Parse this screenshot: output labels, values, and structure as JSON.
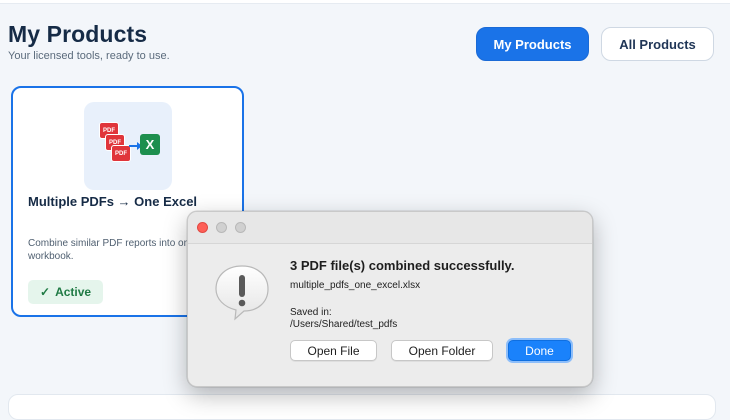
{
  "header": {
    "title": "My Products",
    "subtitle": "Your licensed tools, ready to use."
  },
  "nav": {
    "my_products_label": "My Products",
    "all_products_label": "All Products"
  },
  "product_card": {
    "icon": {
      "pdf_label": "PDF",
      "excel_label": "X"
    },
    "title": "Multiple PDFs → One Excel",
    "description": "Combine similar PDF reports into one workbook.",
    "status_check": "✓",
    "status_label": "Active"
  },
  "dialog": {
    "heading": "3 PDF file(s) combined successfully.",
    "file_name": "multiple_pdfs_one_excel.xlsx",
    "saved_label": "Saved in:",
    "saved_path": "/Users/Shared/test_pdfs",
    "open_file_label": "Open File",
    "open_folder_label": "Open Folder",
    "done_label": "Done"
  },
  "colors": {
    "accent": "#1a73e8",
    "pdf_red": "#e0353b",
    "excel_green": "#1d8f4e",
    "active_green": "#1f7a44",
    "close_red": "#fe5f57",
    "done_blue": "#1a82fb"
  }
}
